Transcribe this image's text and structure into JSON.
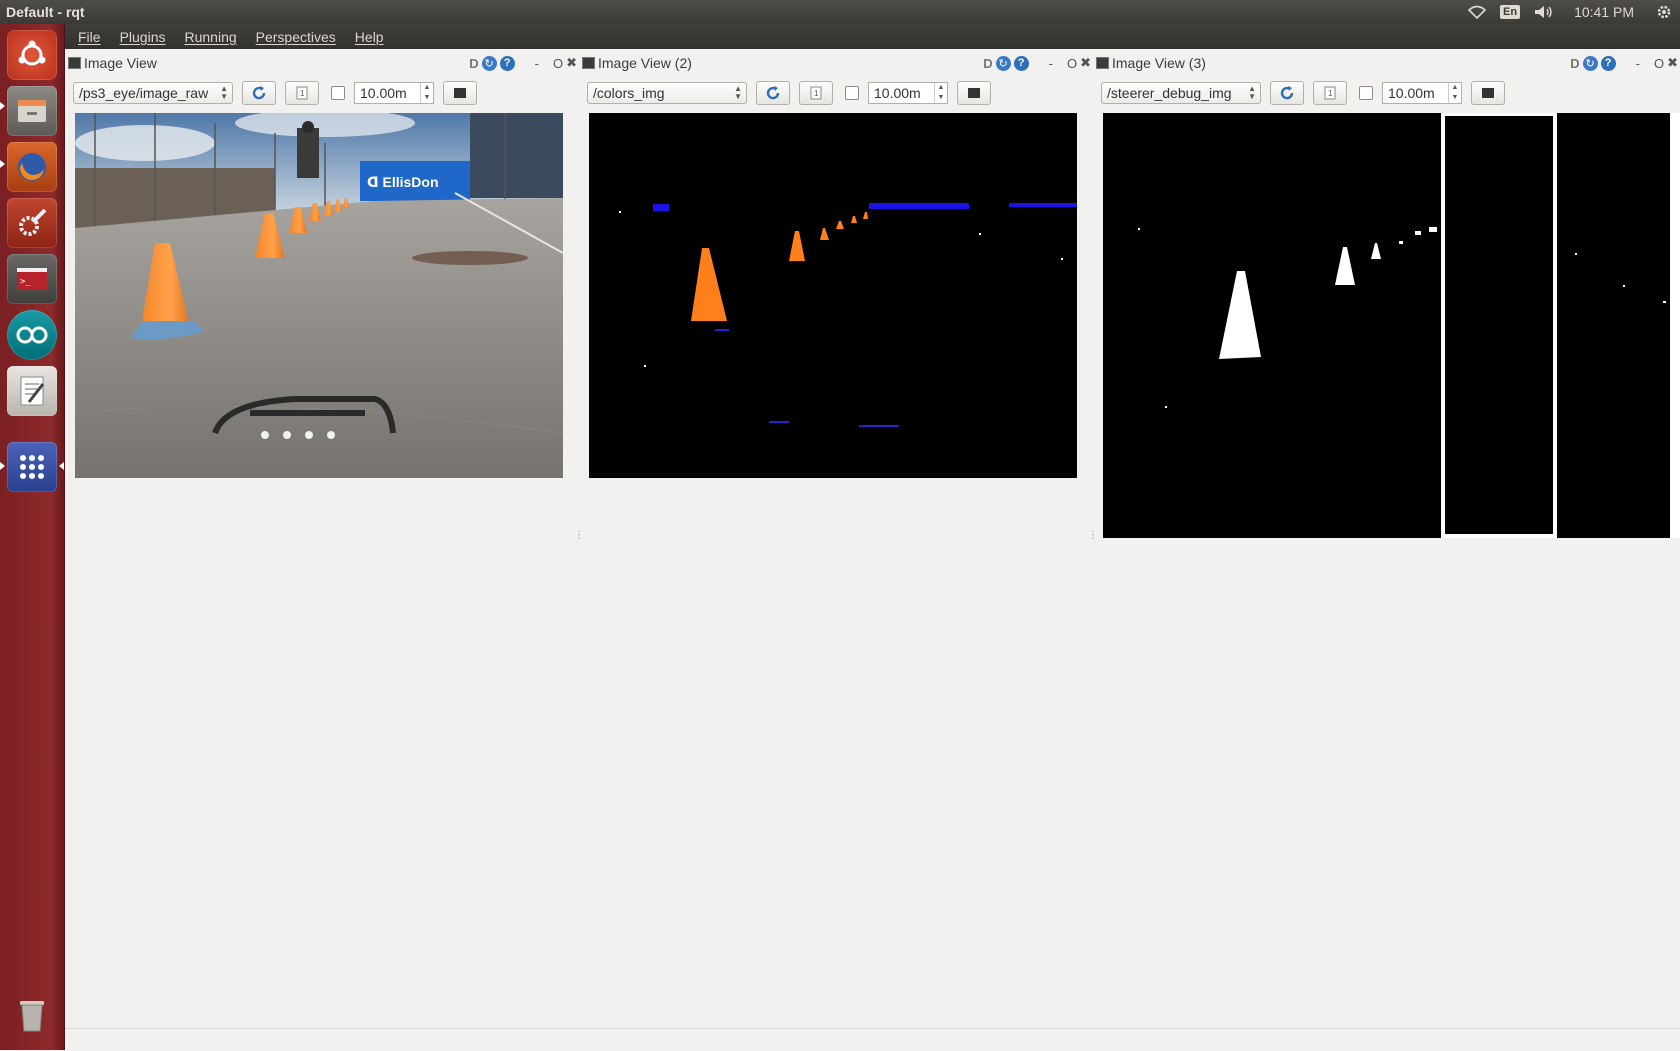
{
  "window": {
    "title": "Default - rqt"
  },
  "tray": {
    "language": "En",
    "time": "10:41 PM"
  },
  "menu": [
    "File",
    "Plugins",
    "Running",
    "Perspectives",
    "Help"
  ],
  "launcher": [
    "ubuntu-dash",
    "files",
    "firefox",
    "system-settings",
    "terminal",
    "arduino",
    "text-editor",
    "apps",
    "trash"
  ],
  "panels": [
    {
      "title": "Image View",
      "topic": "/ps3_eye/image_raw",
      "zoom": "10.00m"
    },
    {
      "title": "Image View (2)",
      "topic": "/colors_img",
      "zoom": "10.00m"
    },
    {
      "title": "Image View (3)",
      "topic": "/steerer_debug_img",
      "zoom": "10.00m"
    }
  ],
  "panel_controls": {
    "d": "D",
    "minimize": "-",
    "float": "O",
    "close": "✖"
  },
  "camera_image": {
    "sign_text": "ᗡ EllisDon"
  }
}
